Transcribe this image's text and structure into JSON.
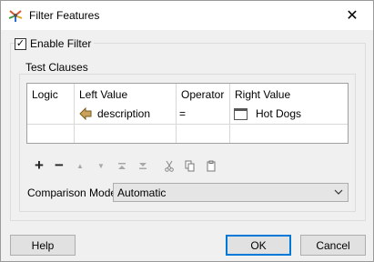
{
  "window": {
    "title": "Filter Features",
    "close_glyph": "✕",
    "app_icon": "fme-workbench-icon"
  },
  "enable_filter": {
    "label": "Enable Filter",
    "checked": true,
    "check_glyph": "✓"
  },
  "test_clauses": {
    "group_label": "Test Clauses",
    "columns": [
      "Logic",
      "Left Value",
      "Operator",
      "Right Value"
    ],
    "rows": [
      {
        "logic": "",
        "left_value": "description",
        "left_icon": "attribute-arrow-icon",
        "operator": "=",
        "right_value": "Hot Dogs",
        "right_icon": "text-value-icon"
      }
    ]
  },
  "toolbar": {
    "add_glyph": "+",
    "remove_glyph": "−",
    "move_up_glyph": "▲",
    "move_down_glyph": "▼",
    "move_top_icon": "move-to-top-icon",
    "move_bottom_icon": "move-to-bottom-icon",
    "cut_icon": "cut-icon",
    "copy_icon": "copy-icon",
    "paste_icon": "paste-icon"
  },
  "comparison_mode": {
    "label": "Comparison Mode:",
    "value": "Automatic"
  },
  "buttons": {
    "help": "Help",
    "ok": "OK",
    "cancel": "Cancel"
  },
  "colors": {
    "accent": "#0078d7",
    "arrow_icon": "#c8a25a"
  }
}
